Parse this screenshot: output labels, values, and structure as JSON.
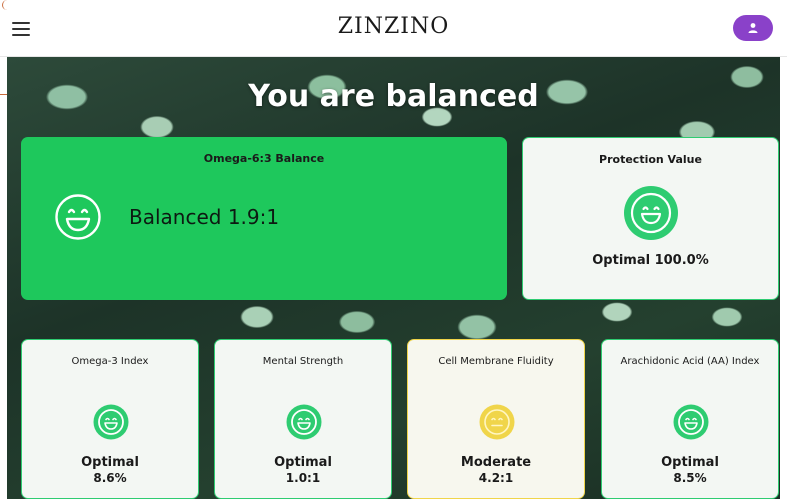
{
  "header": {
    "brand": "ZINZINO",
    "menu_icon": "hamburger-menu-icon",
    "account_icon": "user-icon",
    "account_color": "#8a41c9"
  },
  "hero": {
    "title": "You are balanced"
  },
  "cards": {
    "main": {
      "title": "Omega-6:3 Balance",
      "status": "Balanced 1.9:1",
      "icon": "smiley-happy-icon",
      "color": "#1ec85c"
    },
    "protection": {
      "title": "Protection Value",
      "status": "Optimal 100.0%",
      "icon": "smiley-happy-icon",
      "color": "#2ecc71"
    },
    "small": [
      {
        "title": "Omega-3 Index",
        "status": "Optimal",
        "value": "8.6%",
        "icon": "smiley-happy-icon",
        "color": "#2ecc71"
      },
      {
        "title": "Mental Strength",
        "status": "Optimal",
        "value": "1.0:1",
        "icon": "smiley-happy-icon",
        "color": "#2ecc71"
      },
      {
        "title": "Cell Membrane Fluidity",
        "status": "Moderate",
        "value": "4.2:1",
        "icon": "smiley-neutral-icon",
        "color": "#f0d54a"
      },
      {
        "title": "Arachidonic Acid (AA) Index",
        "status": "Optimal",
        "value": "8.5%",
        "icon": "smiley-happy-icon",
        "color": "#2ecc71"
      }
    ]
  }
}
